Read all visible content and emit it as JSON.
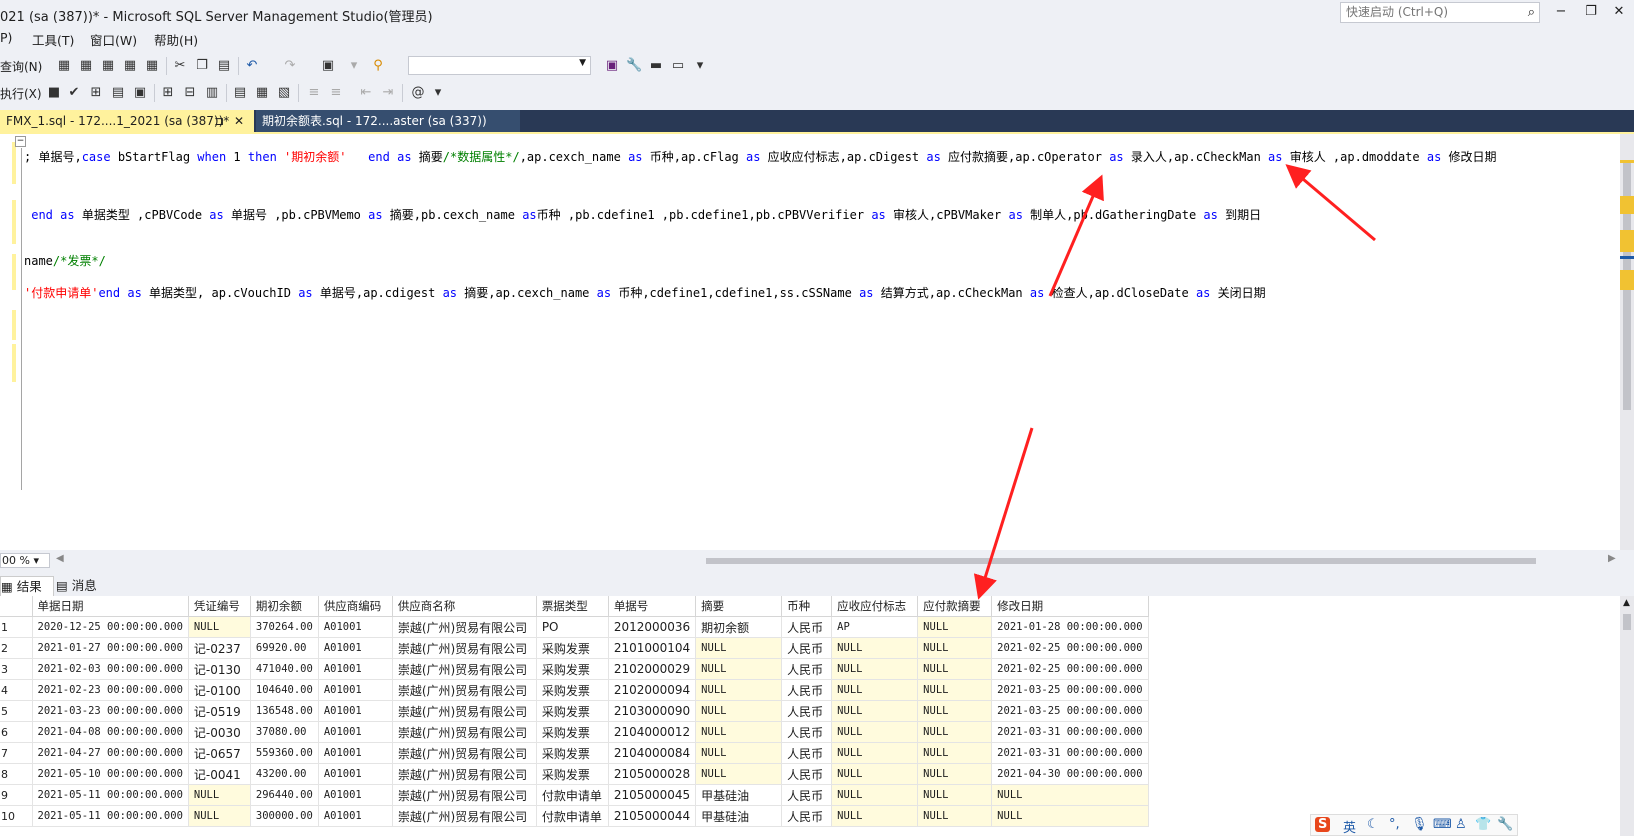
{
  "window": {
    "title": "021 (sa (387))* - Microsoft SQL Server Management Studio(管理员)",
    "quick_launch_placeholder": "快速启动 (Ctrl+Q)",
    "minimize": "−",
    "restore": "❐",
    "close": "✕"
  },
  "menu": [
    "P)",
    "工具(T)",
    "窗口(W)",
    "帮助(H)"
  ],
  "toolbar2": {
    "query_label": "查询(N)",
    "execute_label": "执行(X)"
  },
  "tabs": [
    {
      "label": "FMX_1.sql - 172....1_2021 (sa (387))*",
      "pin": "⊐",
      "close": "✕"
    },
    {
      "label": "期初余额表.sql - 172....aster (sa (337))"
    }
  ],
  "code_lines": {
    "l1": [
      {
        "t": "; 单据号,",
        "c": ""
      },
      {
        "t": "case",
        "c": "kw"
      },
      {
        "t": " bStartFlag ",
        "c": ""
      },
      {
        "t": "when",
        "c": "kw"
      },
      {
        "t": " 1 ",
        "c": ""
      },
      {
        "t": "then",
        "c": "kw"
      },
      {
        "t": " '期初余额'",
        "c": "str"
      },
      {
        "t": "   ",
        "c": ""
      },
      {
        "t": "end",
        "c": "kw"
      },
      {
        "t": " ",
        "c": ""
      },
      {
        "t": "as",
        "c": "kw"
      },
      {
        "t": " 摘要",
        "c": ""
      },
      {
        "t": "/*数据属性*/",
        "c": "cm"
      },
      {
        "t": ",ap.cexch_name ",
        "c": ""
      },
      {
        "t": "as",
        "c": "kw"
      },
      {
        "t": " 币种,ap.cFlag ",
        "c": ""
      },
      {
        "t": "as",
        "c": "kw"
      },
      {
        "t": " 应收应付标志,ap.cDigest ",
        "c": ""
      },
      {
        "t": "as",
        "c": "kw"
      },
      {
        "t": " 应付款摘要,ap.cOperator ",
        "c": ""
      },
      {
        "t": "as",
        "c": "kw"
      },
      {
        "t": " 录入人,ap.cCheckMan ",
        "c": ""
      },
      {
        "t": "as",
        "c": "kw"
      },
      {
        "t": " 审核人 ,ap.dmoddate ",
        "c": ""
      },
      {
        "t": "as",
        "c": "kw"
      },
      {
        "t": " 修改日期",
        "c": ""
      }
    ],
    "l2": [
      {
        "t": " end",
        "c": "kw"
      },
      {
        "t": " ",
        "c": ""
      },
      {
        "t": "as",
        "c": "kw"
      },
      {
        "t": " 单据类型 ,cPBVCode ",
        "c": ""
      },
      {
        "t": "as",
        "c": "kw"
      },
      {
        "t": " 单据号 ,pb.cPBVMemo ",
        "c": ""
      },
      {
        "t": "as",
        "c": "kw"
      },
      {
        "t": " 摘要,pb.cexch_name ",
        "c": ""
      },
      {
        "t": "as",
        "c": "kw"
      },
      {
        "t": "币种 ,pb.cdefine1 ,pb.cdefine1,pb.cPBVVerifier ",
        "c": ""
      },
      {
        "t": "as",
        "c": "kw"
      },
      {
        "t": " 审核人,cPBVMaker ",
        "c": ""
      },
      {
        "t": "as",
        "c": "kw"
      },
      {
        "t": " 制单人,pb.dGatheringDate ",
        "c": ""
      },
      {
        "t": "as",
        "c": "kw"
      },
      {
        "t": " 到期日",
        "c": ""
      }
    ],
    "l3": [
      {
        "t": "name",
        "c": ""
      },
      {
        "t": "/*发票*/",
        "c": "cm"
      }
    ],
    "l4": [
      {
        "t": "'付款申请单'",
        "c": "str"
      },
      {
        "t": "end",
        "c": "kw"
      },
      {
        "t": " ",
        "c": ""
      },
      {
        "t": "as",
        "c": "kw"
      },
      {
        "t": " 单据类型, ap.cVouchID ",
        "c": ""
      },
      {
        "t": "as",
        "c": "kw"
      },
      {
        "t": " 单据号,ap.cdigest ",
        "c": ""
      },
      {
        "t": "as",
        "c": "kw"
      },
      {
        "t": " 摘要,ap.cexch_name ",
        "c": ""
      },
      {
        "t": "as",
        "c": "kw"
      },
      {
        "t": " 币种,cdefine1,cdefine1,ss.cSSName ",
        "c": ""
      },
      {
        "t": "as",
        "c": "kw"
      },
      {
        "t": " 结算方式,ap.cCheckMan ",
        "c": ""
      },
      {
        "t": "as",
        "c": "kw"
      },
      {
        "t": " 检查人,ap.dCloseDate ",
        "c": ""
      },
      {
        "t": "as",
        "c": "kw"
      },
      {
        "t": " 关闭日期",
        "c": ""
      }
    ]
  },
  "zoom": "00 %",
  "results_tabs": {
    "results": "结果",
    "messages": "消息"
  },
  "grid": {
    "columns": [
      "单据日期",
      "凭证编号",
      "期初余额",
      "供应商编码",
      "供应商名称",
      "票据类型",
      "单据号",
      "摘要",
      "币种",
      "应收应付标志",
      "应付款摘要",
      "修改日期"
    ],
    "rows": [
      [
        "1",
        "2020-12-25 00:00:00.000",
        "NULL",
        "370264.00",
        "A01001",
        "崇越(广州)贸易有限公司",
        "PO",
        "2012000036",
        "期初余额",
        "人民币",
        "AP",
        "NULL",
        "2021-01-28 00:00:00.000"
      ],
      [
        "2",
        "2021-01-27 00:00:00.000",
        "记-0237",
        "69920.00",
        "A01001",
        "崇越(广州)贸易有限公司",
        "采购发票",
        "2101000104",
        "NULL",
        "人民币",
        "NULL",
        "NULL",
        "2021-02-25 00:00:00.000"
      ],
      [
        "3",
        "2021-02-03 00:00:00.000",
        "记-0130",
        "471040.00",
        "A01001",
        "崇越(广州)贸易有限公司",
        "采购发票",
        "2102000029",
        "NULL",
        "人民币",
        "NULL",
        "NULL",
        "2021-02-25 00:00:00.000"
      ],
      [
        "4",
        "2021-02-23 00:00:00.000",
        "记-0100",
        "104640.00",
        "A01001",
        "崇越(广州)贸易有限公司",
        "采购发票",
        "2102000094",
        "NULL",
        "人民币",
        "NULL",
        "NULL",
        "2021-03-25 00:00:00.000"
      ],
      [
        "5",
        "2021-03-23 00:00:00.000",
        "记-0519",
        "136548.00",
        "A01001",
        "崇越(广州)贸易有限公司",
        "采购发票",
        "2103000090",
        "NULL",
        "人民币",
        "NULL",
        "NULL",
        "2021-03-25 00:00:00.000"
      ],
      [
        "6",
        "2021-04-08 00:00:00.000",
        "记-0030",
        "37080.00",
        "A01001",
        "崇越(广州)贸易有限公司",
        "采购发票",
        "2104000012",
        "NULL",
        "人民币",
        "NULL",
        "NULL",
        "2021-03-31 00:00:00.000"
      ],
      [
        "7",
        "2021-04-27 00:00:00.000",
        "记-0657",
        "559360.00",
        "A01001",
        "崇越(广州)贸易有限公司",
        "采购发票",
        "2104000084",
        "NULL",
        "人民币",
        "NULL",
        "NULL",
        "2021-03-31 00:00:00.000"
      ],
      [
        "8",
        "2021-05-10 00:00:00.000",
        "记-0041",
        "43200.00",
        "A01001",
        "崇越(广州)贸易有限公司",
        "采购发票",
        "2105000028",
        "NULL",
        "人民币",
        "NULL",
        "NULL",
        "2021-04-30 00:00:00.000"
      ],
      [
        "9",
        "2021-05-11 00:00:00.000",
        "NULL",
        "296440.00",
        "A01001",
        "崇越(广州)贸易有限公司",
        "付款申请单",
        "2105000045",
        "甲基硅油",
        "人民币",
        "NULL",
        "NULL",
        "NULL"
      ],
      [
        "10",
        "2021-05-11 00:00:00.000",
        "NULL",
        "300000.00",
        "A01001",
        "崇越(广州)贸易有限公司",
        "付款申请单",
        "2105000044",
        "甲基硅油",
        "人民币",
        "NULL",
        "NULL",
        "NULL"
      ]
    ]
  },
  "ime_label": "英",
  "colors": {
    "tab_active": "#fff29d",
    "tab_bar": "#293955",
    "annotation_arrow": "#ff2020",
    "null_cell": "#fffbdd"
  }
}
